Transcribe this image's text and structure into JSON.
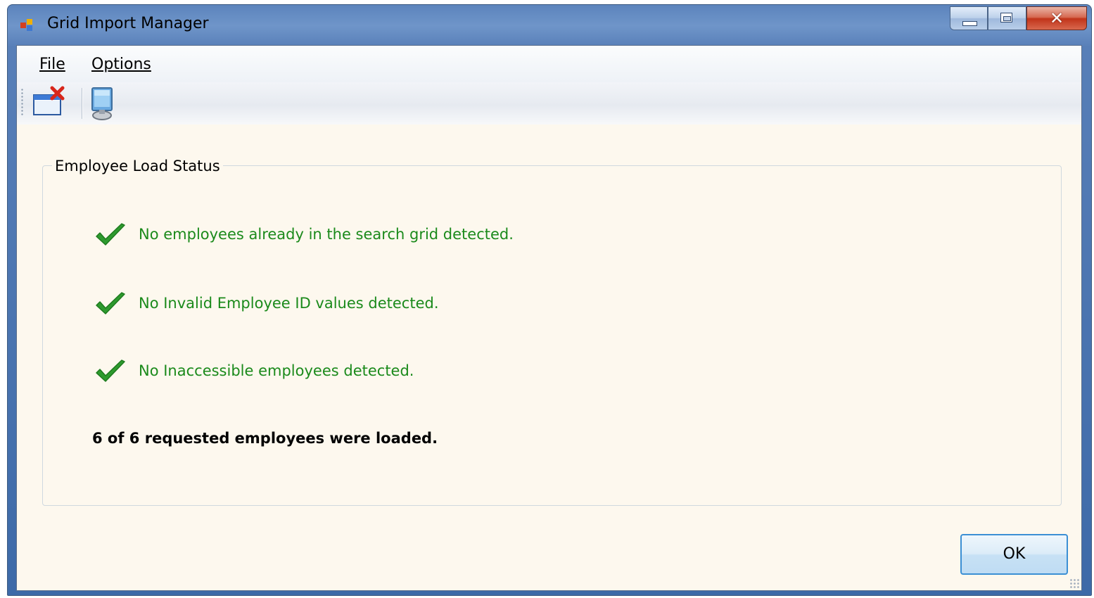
{
  "window": {
    "title": "Grid Import Manager"
  },
  "menu": {
    "file_label": "File",
    "options_label": "Options"
  },
  "toolbar": {
    "icons": [
      "close-window-icon",
      "computer-icon"
    ]
  },
  "group": {
    "legend": "Employee Load Status",
    "checks": [
      {
        "icon": "green-check-icon",
        "text": "No employees already in the search grid detected."
      },
      {
        "icon": "green-check-icon",
        "text": "No Invalid Employee ID values detected."
      },
      {
        "icon": "green-check-icon",
        "text": "No Inaccessible employees detected."
      }
    ],
    "summary": "6 of 6 requested employees were loaded."
  },
  "buttons": {
    "ok_label": "OK"
  },
  "colors": {
    "status_text": "#1b8a1b",
    "check_mark": "#2e9a2e",
    "client_background": "#fdf8ee",
    "title_bar": "#5c84bd",
    "ok_border": "#3b8fd4"
  }
}
